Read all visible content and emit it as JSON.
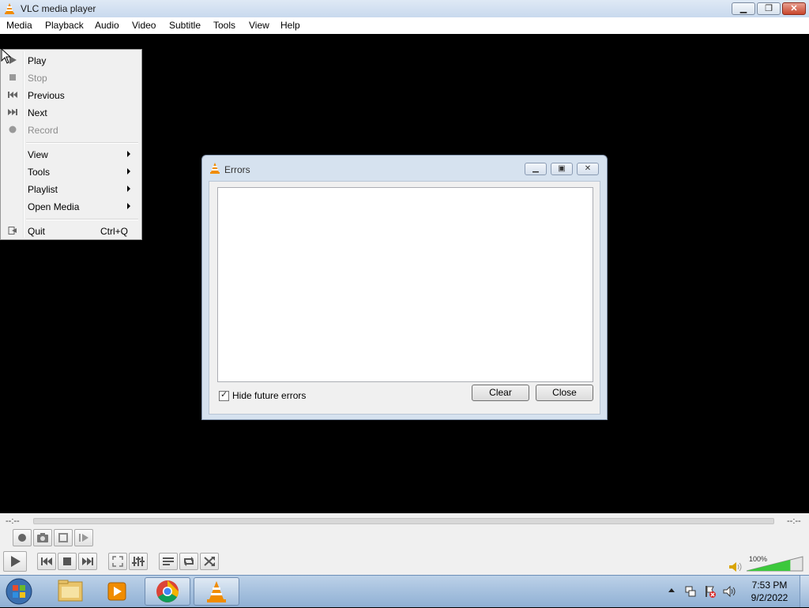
{
  "window": {
    "title": "VLC media player"
  },
  "menubar": [
    "Media",
    "Playback",
    "Audio",
    "Video",
    "Subtitle",
    "Tools",
    "View",
    "Help"
  ],
  "context_menu": {
    "items": [
      {
        "label": "Play",
        "icon": "play-icon",
        "disabled": false
      },
      {
        "label": "Stop",
        "icon": "stop-icon",
        "disabled": true
      },
      {
        "label": "Previous",
        "icon": "previous-icon",
        "disabled": false
      },
      {
        "label": "Next",
        "icon": "next-icon",
        "disabled": false
      },
      {
        "label": "Record",
        "icon": "record-icon",
        "disabled": true
      },
      {
        "label": "View",
        "submenu": true
      },
      {
        "label": "Tools",
        "submenu": true
      },
      {
        "label": "Playlist",
        "submenu": true
      },
      {
        "label": "Open Media",
        "submenu": true
      },
      {
        "label": "Quit",
        "icon": "quit-icon",
        "shortcut": "Ctrl+Q"
      }
    ]
  },
  "errors_dialog": {
    "title": "Errors",
    "hide_future_label": "Hide future errors",
    "hide_future_checked": true,
    "clear_label": "Clear",
    "close_label": "Close"
  },
  "controls": {
    "elapsed": "--:--",
    "remaining": "--:--",
    "volume_percent": "100%",
    "volume_level": 1.0
  },
  "taskbar": {
    "time": "7:53 PM",
    "date": "9/2/2022",
    "apps": [
      "start-button",
      "file-explorer-icon",
      "media-player-icon",
      "chrome-icon",
      "vlc-icon"
    ]
  },
  "colors": {
    "vlc_orange": "#f08c00",
    "volume_green": "#3cc83c"
  }
}
